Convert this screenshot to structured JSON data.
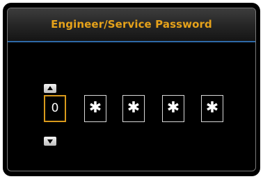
{
  "title": "Engineer/Service Password",
  "digits": [
    "0",
    "✱",
    "✱",
    "✱",
    "✱"
  ],
  "active_digit_index": 0,
  "controls": {
    "up_icon": "up-arrow-icon",
    "down_icon": "down-arrow-icon"
  },
  "colors": {
    "title_text": "#e6a21a",
    "title_underline": "#2e6aa8",
    "active_border": "#d99a1c",
    "background": "#000000"
  }
}
